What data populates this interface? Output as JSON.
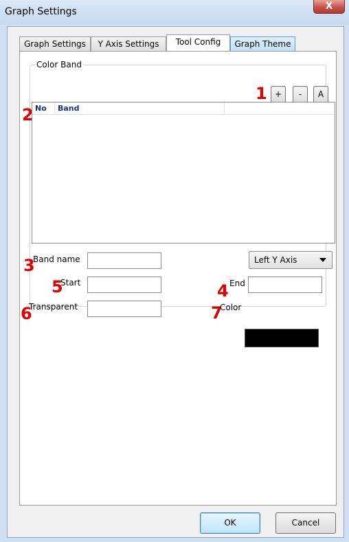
{
  "window": {
    "title": "Graph Settings",
    "close_glyph": "X"
  },
  "tabs": [
    {
      "label": "Graph Settings",
      "active": false
    },
    {
      "label": "Y Axis Settings",
      "active": false
    },
    {
      "label": "Tool Config",
      "active": true
    },
    {
      "label": "Graph Theme",
      "active": false
    }
  ],
  "color_band": {
    "group_title": "Color Band",
    "buttons": {
      "add": "+",
      "remove": "-",
      "auto": "A"
    },
    "list": {
      "columns": [
        "No",
        "Band"
      ],
      "rows": []
    },
    "band_name_label": "Band name",
    "band_name_value": "",
    "start_label": "Start",
    "start_value": "",
    "end_label": "End",
    "end_value": "",
    "transparent_label": "Transparent",
    "transparent_value": "",
    "color_label": "Color",
    "color_value": "#000000",
    "axis_select": "Left Y Axis"
  },
  "annotations": [
    "1",
    "2",
    "3",
    "4",
    "5",
    "6",
    "7"
  ],
  "dialog_buttons": {
    "ok": "OK",
    "cancel": "Cancel"
  },
  "colors": {
    "annotation": "#e00000",
    "title_bar": "#cfe0f3",
    "close_button": "#c75050",
    "list_header_text": "#1a2f8a"
  }
}
